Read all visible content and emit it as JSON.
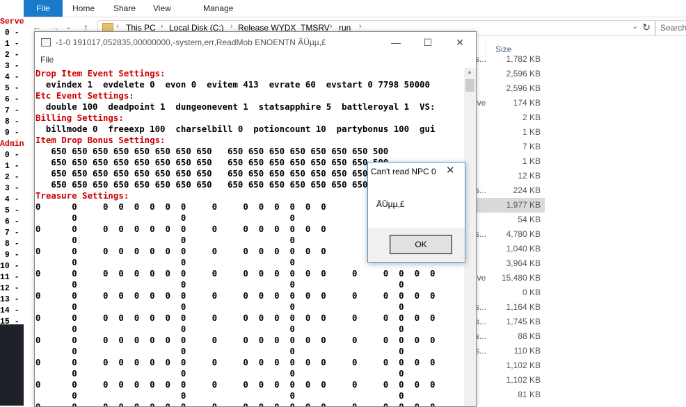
{
  "background_console": {
    "lines": [
      {
        "text": "Serve",
        "red": true
      },
      {
        "text": " 0 -",
        "red": false
      },
      {
        "text": " 1 -",
        "red": false
      },
      {
        "text": " 2 -",
        "red": false
      },
      {
        "text": " 3 -",
        "red": false
      },
      {
        "text": " 4 -",
        "red": false
      },
      {
        "text": " 5 -",
        "red": false
      },
      {
        "text": " 6 -",
        "red": false
      },
      {
        "text": " 7 -",
        "red": false
      },
      {
        "text": " 8 -",
        "red": false
      },
      {
        "text": " 9 -",
        "red": false
      },
      {
        "text": "Admin",
        "red": true
      },
      {
        "text": " 0 -",
        "red": false
      },
      {
        "text": " 1 -",
        "red": false
      },
      {
        "text": " 2 -",
        "red": false
      },
      {
        "text": " 3 -",
        "red": false
      },
      {
        "text": " 4 -",
        "red": false
      },
      {
        "text": " 5 -",
        "red": false
      },
      {
        "text": " 6 -",
        "red": false
      },
      {
        "text": " 7 -",
        "red": false
      },
      {
        "text": " 8 -",
        "red": false
      },
      {
        "text": " 9 -",
        "red": false
      },
      {
        "text": "10 -",
        "red": false
      },
      {
        "text": "11 -",
        "red": false
      },
      {
        "text": "12 -",
        "red": false
      },
      {
        "text": "13 -",
        "red": false
      },
      {
        "text": "14 -",
        "red": false
      },
      {
        "text": "15 -",
        "red": false
      }
    ]
  },
  "explorer": {
    "tabs": {
      "file": "File",
      "home": "Home",
      "share": "Share",
      "view": "View",
      "manage": "Manage"
    },
    "breadcrumb": [
      "This PC",
      "Local Disk (C:)",
      "Release WYDX",
      "TMSRV",
      "run"
    ],
    "search_placeholder": "Search",
    "size_header": "Size",
    "rows": [
      {
        "type": "s...",
        "size": "1,782 KB",
        "selected": false
      },
      {
        "type": "",
        "size": "2,596 KB",
        "selected": false
      },
      {
        "type": "",
        "size": "2,596 KB",
        "selected": false
      },
      {
        "type": "ive",
        "size": "174 KB",
        "selected": false
      },
      {
        "type": "",
        "size": "2 KB",
        "selected": false
      },
      {
        "type": "",
        "size": "1 KB",
        "selected": false
      },
      {
        "type": "",
        "size": "7 KB",
        "selected": false
      },
      {
        "type": "",
        "size": "1 KB",
        "selected": false
      },
      {
        "type": "",
        "size": "12 KB",
        "selected": false
      },
      {
        "type": "s...",
        "size": "224 KB",
        "selected": false
      },
      {
        "type": "",
        "size": "1,977 KB",
        "selected": true
      },
      {
        "type": "",
        "size": "54 KB",
        "selected": false
      },
      {
        "type": "s...",
        "size": "4,780 KB",
        "selected": false
      },
      {
        "type": "",
        "size": "1,040 KB",
        "selected": false
      },
      {
        "type": "",
        "size": "3,964 KB",
        "selected": false
      },
      {
        "type": "ive",
        "size": "15,480 KB",
        "selected": false
      },
      {
        "type": "",
        "size": "0 KB",
        "selected": false
      },
      {
        "type": "s...",
        "size": "1,164 KB",
        "selected": false
      },
      {
        "type": "s...",
        "size": "1,745 KB",
        "selected": false
      },
      {
        "type": "s...",
        "size": "88 KB",
        "selected": false
      },
      {
        "type": "s...",
        "size": "110 KB",
        "selected": false
      },
      {
        "type": "",
        "size": "1,102 KB",
        "selected": false
      },
      {
        "type": "",
        "size": "1,102 KB",
        "selected": false
      },
      {
        "type": "",
        "size": "81 KB",
        "selected": false
      }
    ]
  },
  "main_window": {
    "title": "-1-0 191017,052835,00000000,-system,err,ReadMob ENOENTN ÄÜµµ,£",
    "menu_file": "File",
    "console_lines": [
      {
        "text": "Drop Item Event Settings:",
        "heading": true
      },
      {
        "text": "  evindex 1  evdelete 0  evon 0  evitem 413  evrate 60  evstart 0 7798 50000",
        "heading": false
      },
      {
        "text": "Etc Event Settings:",
        "heading": true
      },
      {
        "text": "  double 100  deadpoint 1  dungeonevent 1  statsapphire 5  battleroyal 1  VS:",
        "heading": false
      },
      {
        "text": "Billing Settings:",
        "heading": true
      },
      {
        "text": "  billmode 0  freeexp 100  charselbill 0  potioncount 10  partybonus 100  gui",
        "heading": false
      },
      {
        "text": "Item Drop Bonus Settings:",
        "heading": true
      },
      {
        "text": "   650 650 650 650 650 650 650 650   650 650 650 650 650 650 650 500",
        "heading": false
      },
      {
        "text": "   650 650 650 650 650 650 650 650   650 650 650 650 650 650 650 500",
        "heading": false
      },
      {
        "text": "   650 650 650 650 650 650 650 650   650 650 650 650 650 650 650 650",
        "heading": false
      },
      {
        "text": "   650 650 650 650 650 650 650 650   650 650 650 650 650 650 650 650",
        "heading": false
      },
      {
        "text": "Treasure Settings:",
        "heading": true
      },
      {
        "text": "0      0     0  0  0  0  0  0     0     0  0  0  0  0  0",
        "heading": false
      },
      {
        "text": "       0                    0                    0",
        "heading": false
      },
      {
        "text": "0      0     0  0  0  0  0  0     0     0  0  0  0  0  0",
        "heading": false
      },
      {
        "text": "       0                    0                    0",
        "heading": false
      },
      {
        "text": "0      0     0  0  0  0  0  0     0     0  0  0  0  0  0",
        "heading": false
      },
      {
        "text": "       0                    0                    0",
        "heading": false
      },
      {
        "text": "0      0     0  0  0  0  0  0     0     0  0  0  0  0  0     0     0  0  0  0",
        "heading": false
      },
      {
        "text": "       0                    0                    0                    0",
        "heading": false
      },
      {
        "text": "0      0     0  0  0  0  0  0     0     0  0  0  0  0  0     0     0  0  0  0",
        "heading": false
      },
      {
        "text": "       0                    0                    0                    0",
        "heading": false
      },
      {
        "text": "0      0     0  0  0  0  0  0     0     0  0  0  0  0  0     0     0  0  0  0",
        "heading": false
      },
      {
        "text": "       0                    0                    0                    0",
        "heading": false
      },
      {
        "text": "0      0     0  0  0  0  0  0     0     0  0  0  0  0  0     0     0  0  0  0",
        "heading": false
      },
      {
        "text": "       0                    0                    0                    0",
        "heading": false
      },
      {
        "text": "0      0     0  0  0  0  0  0     0     0  0  0  0  0  0     0     0  0  0  0",
        "heading": false
      },
      {
        "text": "       0                    0                    0                    0",
        "heading": false
      },
      {
        "text": "0      0     0  0  0  0  0  0     0     0  0  0  0  0  0     0     0  0  0  0",
        "heading": false
      },
      {
        "text": "       0                    0                    0                    0",
        "heading": false
      },
      {
        "text": "0      0     0  0  0  0  0  0     0     0  0  0  0  0  0     0     0  0  0  0",
        "heading": false
      }
    ]
  },
  "dialog": {
    "title": "Can't read NPC 0",
    "message": "ÄÜµµ,£",
    "ok_label": "OK"
  },
  "colors": {
    "heading_red": "#cc0000",
    "file_tab_blue": "#1979ca",
    "selection_gray": "#d9d9d9"
  }
}
